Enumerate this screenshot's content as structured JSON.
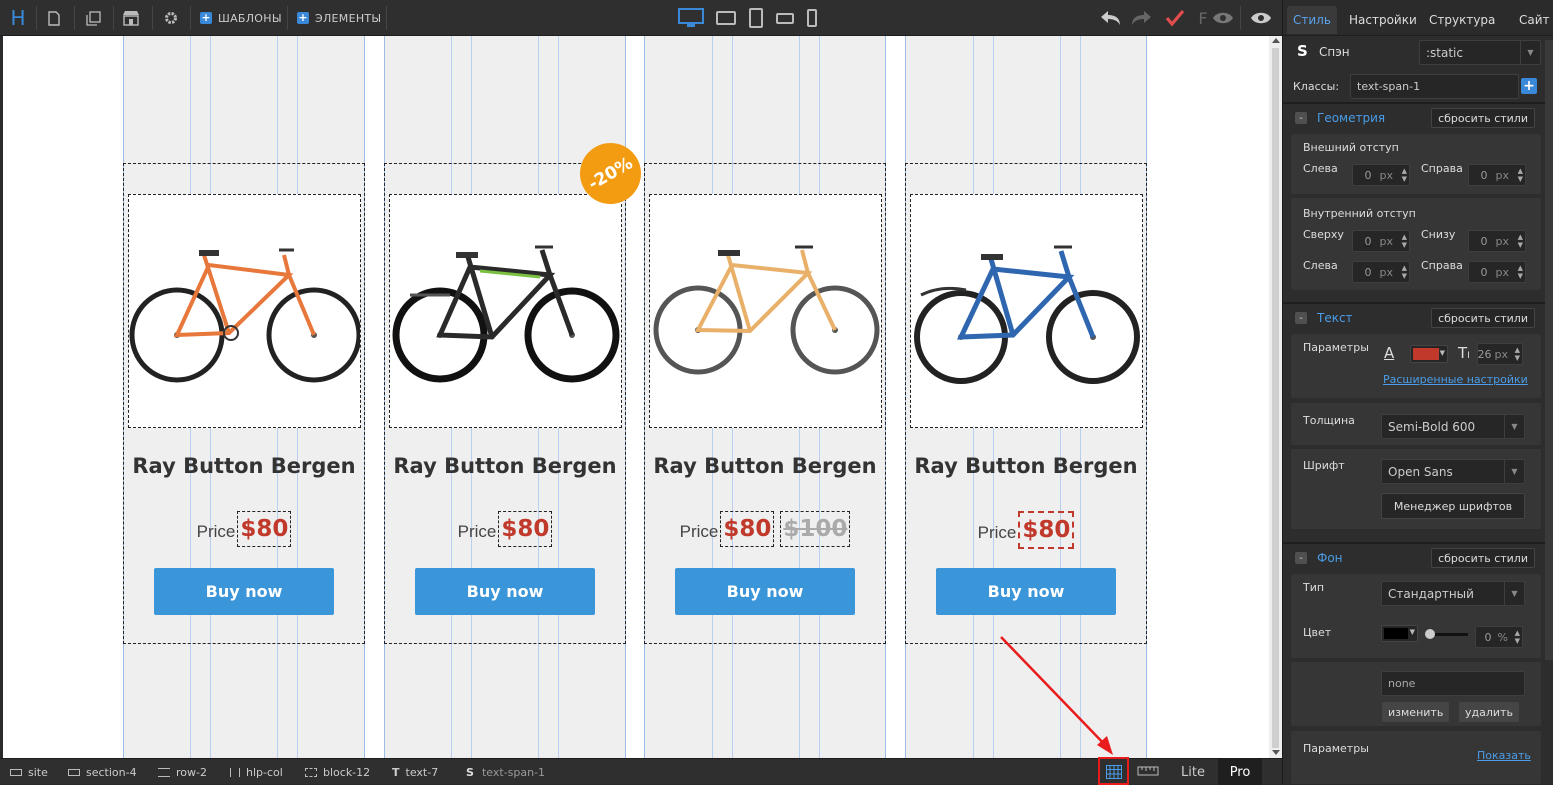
{
  "toolbar": {
    "logo": "H",
    "templates_label": "ШАБЛОНЫ",
    "elements_label": "ЭЛЕМЕНТЫ",
    "f_label": "F"
  },
  "products": [
    {
      "title": "Ray Button Bergen",
      "price_label": "Price",
      "price": "$80",
      "old_price": "",
      "button": "Buy now"
    },
    {
      "title": "Ray Button Bergen",
      "price_label": "Price",
      "price": "$80",
      "old_price": "",
      "button": "Buy now",
      "badge": "-20%"
    },
    {
      "title": "Ray Button Bergen",
      "price_label": "Price",
      "price": "$80",
      "old_price": "$100",
      "button": "Buy now"
    },
    {
      "title": "Ray Button Bergen",
      "price_label": "Price",
      "price": "$80",
      "old_price": "",
      "button": "Buy now"
    }
  ],
  "breadcrumbs": [
    "site",
    "section-4",
    "row-2",
    "hlp-col",
    "block-12",
    "text-7",
    "text-span-1"
  ],
  "status": {
    "lite": "Lite",
    "pro": "Pro"
  },
  "panel": {
    "tabs": [
      "Стиль",
      "Настройки",
      "Структура",
      "Сайт"
    ],
    "element_icon": "S",
    "element_name": "Спэн",
    "position_value": ":static",
    "classes_label": "Классы:",
    "class_value": "text-span-1",
    "geometry": {
      "title": "Геометрия",
      "reset": "сбросить стили",
      "margin_title": "Внешний отступ",
      "padding_title": "Внутренний отступ",
      "left": "Слева",
      "right": "Справа",
      "top": "Сверху",
      "bottom": "Снизу",
      "zero": "0",
      "unit": "px"
    },
    "text": {
      "title": "Текст",
      "reset": "сбросить стили",
      "params_label": "Параметры",
      "font_size": "26",
      "unit": "px",
      "advanced_link": "Расширенные настройки",
      "weight_label": "Толщина",
      "weight_value": "Semi-Bold 600",
      "font_label": "Шрифт",
      "font_value": "Open Sans",
      "font_manager": "Менеджер шрифтов",
      "color": "#c0392b"
    },
    "background": {
      "title": "Фон",
      "reset": "сбросить стили",
      "type_label": "Тип",
      "type_value": "Стандартный",
      "color_label": "Цвет",
      "opacity": "0",
      "opacity_unit": "%",
      "image_value": "none",
      "change": "изменить",
      "delete": "удалить",
      "params_label": "Параметры",
      "show_link": "Показать",
      "color": "#000000"
    }
  }
}
